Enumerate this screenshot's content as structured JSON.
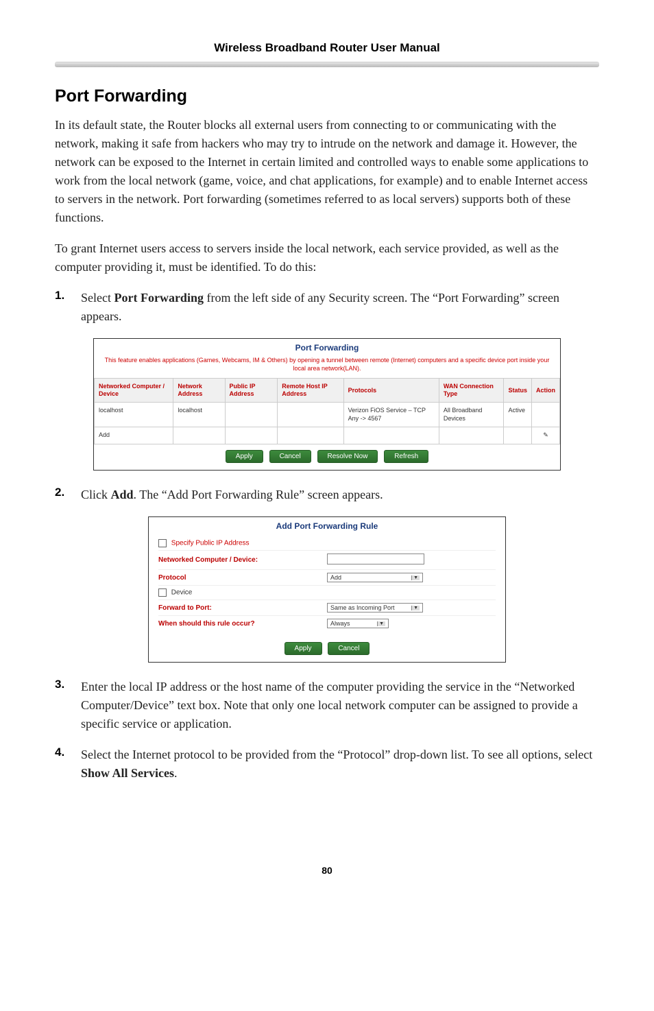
{
  "header": {
    "title": "Wireless Broadband Router User Manual"
  },
  "section": {
    "heading": "Port Forwarding"
  },
  "para1": "In its default state, the Router blocks all external users from connecting to or communicating with the network, making it safe from hackers who may try to intrude on the network and damage it. However, the network can be exposed to the Internet in certain limited and controlled ways to enable some applications to work from the local network (game, voice, and chat applications, for example) and to enable Internet access to servers in the network. Port forwarding (sometimes referred to as local servers) supports both of these functions.",
  "para2": "To grant Internet users access to servers inside the local network, each service provided, as well as the computer providing it, must be identified. To do this:",
  "steps": {
    "s1_num": "1.",
    "s1_pre": "Select ",
    "s1_bold": "Port Forwarding",
    "s1_post": " from the left side of any Security screen. The “Port Forwarding” screen appears.",
    "s2_num": "2.",
    "s2_pre": "Click ",
    "s2_bold": "Add",
    "s2_post": ". The “Add Port Forwarding Rule” screen appears.",
    "s3_num": "3.",
    "s3_pre": "Enter the local ",
    "s3_sc": "IP",
    "s3_post": " address or the host name of the computer providing the service in the “Networked Computer/Device” text box. Note that only one local network computer can be assigned to provide a specific service or application.",
    "s4_num": "4.",
    "s4_pre": "Select the Internet protocol to be provided from the “Protocol” drop-down list. To see all options, select ",
    "s4_bold": "Show All Services",
    "s4_post": "."
  },
  "pf": {
    "title": "Port Forwarding",
    "desc": "This feature enables applications (Games, Webcams, IM & Others) by opening a tunnel between remote (Internet) computers and a specific device port inside your local area network(LAN).",
    "headers": {
      "h1": "Networked Computer / Device",
      "h2": "Network Address",
      "h3": "Public IP Address",
      "h4": "Remote Host IP Address",
      "h5": "Protocols",
      "h6": "WAN Connection Type",
      "h7": "Status",
      "h8": "Action"
    },
    "row": {
      "c1": "localhost",
      "c2": "localhost",
      "c3": "",
      "c4": "",
      "c5": "Verizon FiOS Service – TCP Any -> 4567",
      "c6": "All Broadband Devices",
      "c7": "Active",
      "c8": ""
    },
    "add_row": "Add",
    "buttons": {
      "b1": "Apply",
      "b2": "Cancel",
      "b3": "Resolve Now",
      "b4": "Refresh"
    }
  },
  "addrule": {
    "title": "Add Port Forwarding Rule",
    "specify": "Specify Public IP Address",
    "device_label": "Networked Computer / Device:",
    "protocol_label": "Protocol",
    "protocol_value": "Add",
    "device_cb": "Device",
    "forward_label": "Forward to Port:",
    "forward_value": "Same as Incoming Port",
    "when_label": "When should this rule occur?",
    "when_value": "Always",
    "btn_apply": "Apply",
    "btn_cancel": "Cancel"
  },
  "footer": {
    "page": "80"
  }
}
